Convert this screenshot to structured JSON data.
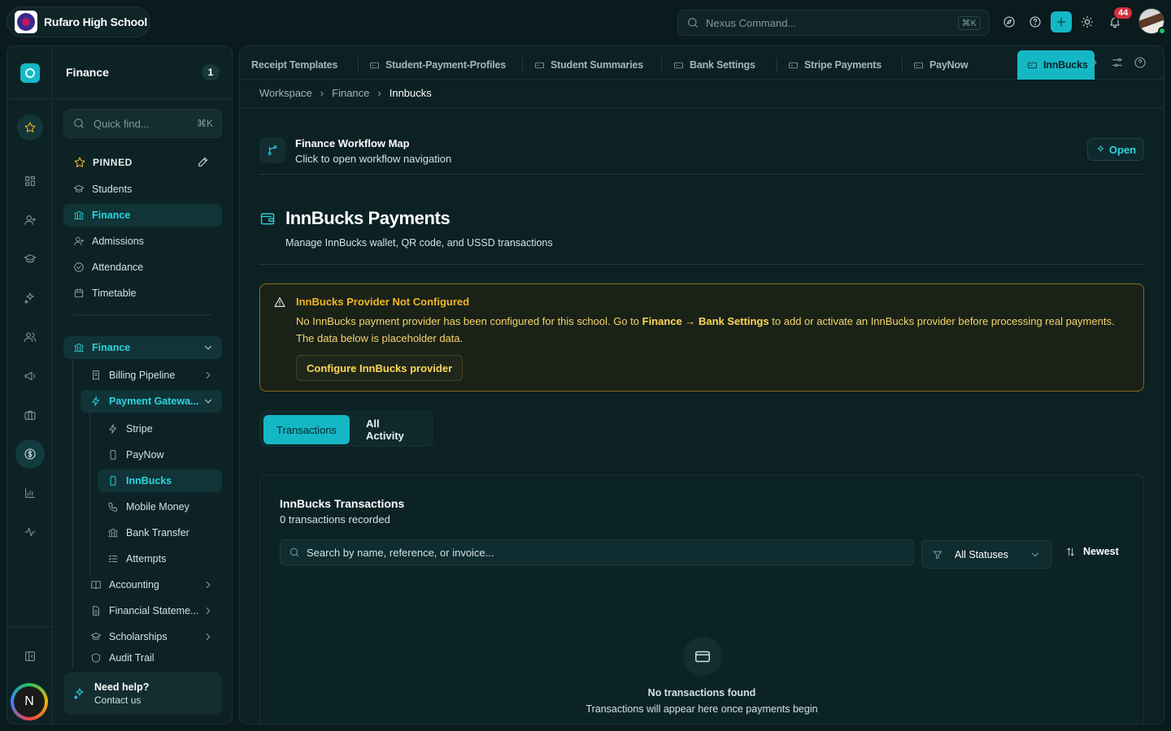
{
  "header": {
    "school_name": "Rufaro High School",
    "command_placeholder": "Nexus Command...",
    "command_shortcut": "⌘K",
    "notifications_count": "44"
  },
  "sidebar": {
    "title": "Finance",
    "count": "1",
    "quick_find_placeholder": "Quick find...",
    "quick_find_shortcut": "⌘K",
    "pinned_label": "PINNED",
    "pinned": [
      {
        "label": "Students",
        "icon": "graduation-cap-icon"
      },
      {
        "label": "Finance",
        "icon": "bank-icon",
        "active": true
      },
      {
        "label": "Admissions",
        "icon": "user-plus-icon"
      },
      {
        "label": "Attendance",
        "icon": "check-circle-icon"
      },
      {
        "label": "Timetable",
        "icon": "calendar-icon"
      }
    ],
    "section": {
      "label": "Finance",
      "icon": "bank-icon"
    },
    "tree": [
      {
        "label": "Billing Pipeline",
        "icon": "receipt-icon"
      },
      {
        "label": "Payment Gatewa...",
        "icon": "bolt-icon",
        "active": true
      },
      {
        "label": "Stripe",
        "icon": "bolt-icon"
      },
      {
        "label": "PayNow",
        "icon": "phone-icon"
      },
      {
        "label": "InnBucks",
        "icon": "phone-icon",
        "active": true
      },
      {
        "label": "Mobile Money",
        "icon": "call-icon"
      },
      {
        "label": "Bank Transfer",
        "icon": "bank-icon"
      },
      {
        "label": "Attempts",
        "icon": "list-check-icon"
      },
      {
        "label": "Accounting",
        "icon": "book-icon"
      },
      {
        "label": "Financial Stateme...",
        "icon": "document-icon"
      },
      {
        "label": "Scholarships",
        "icon": "graduation-cap-icon"
      },
      {
        "label": "Audit Trail",
        "icon": "shield-icon"
      }
    ],
    "help_title": "Need help?",
    "help_link": "Contact us",
    "user_initial": "N"
  },
  "tabs": [
    {
      "label": "Receipt Templates"
    },
    {
      "label": "Student-Payment-Profiles"
    },
    {
      "label": "Student Summaries"
    },
    {
      "label": "Bank Settings"
    },
    {
      "label": "Stripe Payments"
    },
    {
      "label": "PayNow"
    },
    {
      "label": "InnBucks",
      "active": true
    }
  ],
  "breadcrumb": [
    "Workspace",
    "Finance",
    "Innbucks"
  ],
  "workflow": {
    "title": "Finance Workflow Map",
    "subtitle": "Click to open workflow navigation",
    "open_label": "Open"
  },
  "page": {
    "title": "InnBucks Payments",
    "subtitle": "Manage InnBucks wallet, QR code, and USSD transactions"
  },
  "alert": {
    "title": "InnBucks Provider Not Configured",
    "body_pre": "No InnBucks payment provider has been configured for this school. Go to ",
    "body_bold": "Finance → Bank Settings",
    "body_post": " to add or activate an InnBucks provider before processing real payments. The data below is placeholder data.",
    "button": "Configure InnBucks provider"
  },
  "view_tabs": [
    {
      "label": "Transactions",
      "active": true
    },
    {
      "label": "All Activity"
    }
  ],
  "transactions": {
    "title": "InnBucks Transactions",
    "count_text": "0 transactions recorded",
    "search_placeholder": "Search by name, reference, or invoice...",
    "status_filter": "All Statuses",
    "sort_label": "Newest",
    "empty_title": "No transactions found",
    "empty_subtitle": "Transactions will appear here once payments begin"
  },
  "colors": {
    "accent": "#14b8c4",
    "warning": "#f2b524",
    "background": "#0a1a1d"
  }
}
